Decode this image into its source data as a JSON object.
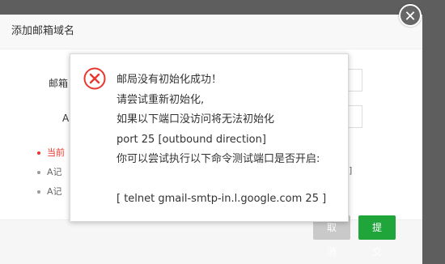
{
  "dialog": {
    "title": "添加邮箱域名",
    "fields": [
      {
        "label": "邮箱"
      },
      {
        "label": "A"
      }
    ],
    "bullets": [
      {
        "text": "当前",
        "color": "#e8382f"
      },
      {
        "text": "A记",
        "color": "#666666"
      },
      {
        "text": "A记",
        "color": "#666666"
      }
    ],
    "bullet_tail": "]",
    "cancel_label": "取消",
    "submit_label": "提交",
    "close_glyph": "✕"
  },
  "alert": {
    "icon": "error-circle-icon",
    "lines": [
      "邮局没有初始化成功！",
      "请尝试重新初始化,",
      "如果以下端口没访问将无法初始化",
      "port 25 [outbound direction]",
      "你可以尝试执行以下命令测试端口是否开启:",
      "",
      "[ telnet gmail-smtp-in.l.google.com 25 ]"
    ]
  },
  "colors": {
    "overlay": "#5e5e5e",
    "accent_green": "#20a53a",
    "error_red": "#e8382f"
  }
}
